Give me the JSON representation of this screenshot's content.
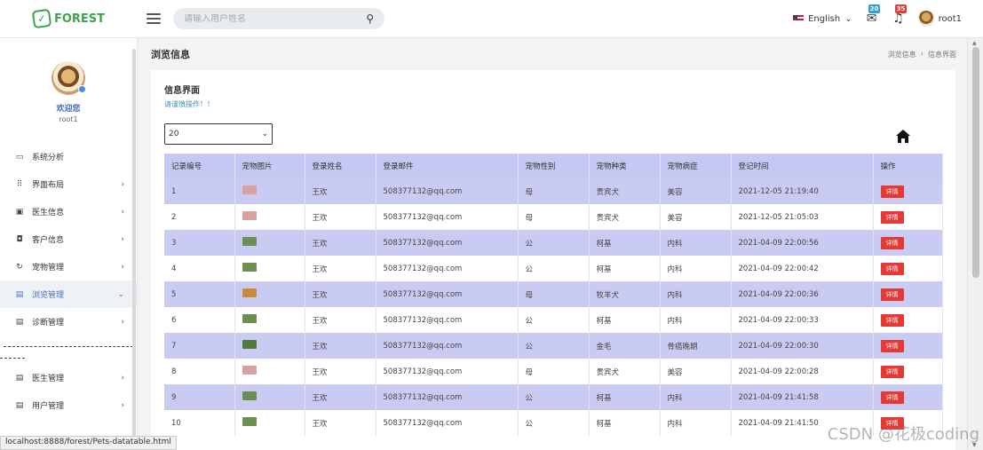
{
  "brand": {
    "name": "FOREST",
    "color": "#3fa34d"
  },
  "search": {
    "placeholder": "请输入用户姓名"
  },
  "topbar": {
    "language": "English",
    "mail_count": "20",
    "alert_count": "35",
    "username": "root1"
  },
  "profile": {
    "welcome": "欢迎您",
    "username": "root1"
  },
  "sidebar": {
    "items": [
      {
        "label": "系统分析",
        "icon": "monitor-icon",
        "glyph": "▭",
        "chev": ""
      },
      {
        "label": "界面布局",
        "icon": "grid-icon",
        "glyph": "⠿",
        "chev": "›"
      },
      {
        "label": "医生信息",
        "icon": "calendar-icon",
        "glyph": "▣",
        "chev": "›"
      },
      {
        "label": "客户信息",
        "icon": "briefcase-icon",
        "glyph": "◘",
        "chev": "›"
      },
      {
        "label": "宠物管理",
        "icon": "refresh-icon",
        "glyph": "↻",
        "chev": "›"
      },
      {
        "label": "浏览管理",
        "icon": "document-icon",
        "glyph": "▤",
        "chev": "⌄",
        "active": true
      },
      {
        "label": "诊断管理",
        "icon": "document-icon",
        "glyph": "▤",
        "chev": "›"
      }
    ],
    "items2": [
      {
        "label": "医生管理",
        "icon": "document-icon",
        "glyph": "▤",
        "chev": "›"
      },
      {
        "label": "用户管理",
        "icon": "document-icon",
        "glyph": "▤",
        "chev": "›"
      }
    ]
  },
  "page": {
    "title": "浏览信息",
    "breadcrumb": [
      "浏览信息",
      "›",
      "信息界面"
    ]
  },
  "card": {
    "title": "信息界面",
    "subtitle": "请谨慎操作！！",
    "page_size": "20"
  },
  "table": {
    "headers": [
      "记录编号",
      "宠物图片",
      "登录姓名",
      "登录邮件",
      "宠物性别",
      "宠物种类",
      "宠物病症",
      "登记时间",
      "操作"
    ],
    "detail_label": "详情",
    "rows": [
      {
        "id": "1",
        "pet": "#d9a0a0",
        "name": "王欢",
        "email": "508377132@qq.com",
        "sex": "母",
        "kind": "贵宾犬",
        "disease": "美容",
        "time": "2021-12-05 21:19:40"
      },
      {
        "id": "2",
        "pet": "#d9a0a0",
        "name": "王欢",
        "email": "508377132@qq.com",
        "sex": "母",
        "kind": "贵宾犬",
        "disease": "美容",
        "time": "2021-12-05 21:05:03"
      },
      {
        "id": "3",
        "pet": "#6b8f4e",
        "name": "王欢",
        "email": "508377132@qq.com",
        "sex": "公",
        "kind": "柯基",
        "disease": "内科",
        "time": "2021-04-09 22:00:56"
      },
      {
        "id": "4",
        "pet": "#6b8f4e",
        "name": "王欢",
        "email": "508377132@qq.com",
        "sex": "公",
        "kind": "柯基",
        "disease": "内科",
        "time": "2021-04-09 22:00:42"
      },
      {
        "id": "5",
        "pet": "#c98a3a",
        "name": "王欢",
        "email": "508377132@qq.com",
        "sex": "母",
        "kind": "牧羊犬",
        "disease": "内科",
        "time": "2021-04-09 22:00:36"
      },
      {
        "id": "6",
        "pet": "#6b8f4e",
        "name": "王欢",
        "email": "508377132@qq.com",
        "sex": "公",
        "kind": "柯基",
        "disease": "内科",
        "time": "2021-04-09 22:00:33"
      },
      {
        "id": "7",
        "pet": "#4f7a3a",
        "name": "王欢",
        "email": "508377132@qq.com",
        "sex": "公",
        "kind": "金毛",
        "disease": "骨癌晚期",
        "time": "2021-04-09 22:00:30"
      },
      {
        "id": "8",
        "pet": "#d9a0a0",
        "name": "王欢",
        "email": "508377132@qq.com",
        "sex": "母",
        "kind": "贵宾犬",
        "disease": "美容",
        "time": "2021-04-09 22:00:28"
      },
      {
        "id": "9",
        "pet": "#6b8f4e",
        "name": "王欢",
        "email": "508377132@qq.com",
        "sex": "公",
        "kind": "柯基",
        "disease": "内科",
        "time": "2021-04-09 21:41:58"
      },
      {
        "id": "10",
        "pet": "#6b8f4e",
        "name": "王欢",
        "email": "508377132@qq.com",
        "sex": "公",
        "kind": "柯基",
        "disease": "内科",
        "time": "2021-04-09 21:41:50"
      }
    ]
  },
  "status_url": "localhost:8888/forest/Pets-datatable.html",
  "watermark": "CSDN @花极coding"
}
